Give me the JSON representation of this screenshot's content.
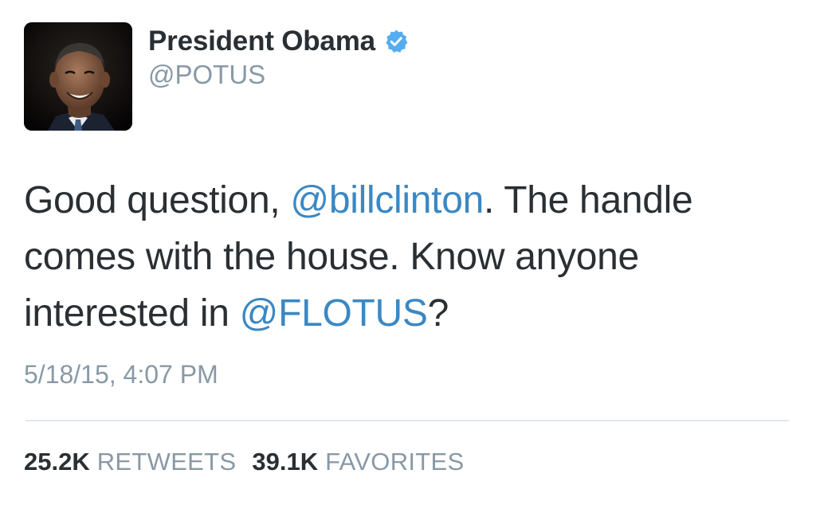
{
  "tweet": {
    "author": {
      "name": "President Obama",
      "handle": "@POTUS",
      "verified": true,
      "avatar_icon": "profile-photo"
    },
    "text": {
      "part1": "Good question, ",
      "mention1": "@billclinton",
      "part2": ". The handle comes with the house. Know anyone interested in ",
      "mention2": "@FLOTUS",
      "part3": "?"
    },
    "timestamp": "5/18/15, 4:07 PM",
    "stats": {
      "retweets_count": "25.2K",
      "retweets_label": "RETWEETS",
      "favorites_count": "39.1K",
      "favorites_label": "FAVORITES"
    }
  },
  "colors": {
    "link": "#3b88c3",
    "muted": "#8899a6",
    "text": "#292f33",
    "verified": "#55acee",
    "divider": "#e1e8ed"
  }
}
